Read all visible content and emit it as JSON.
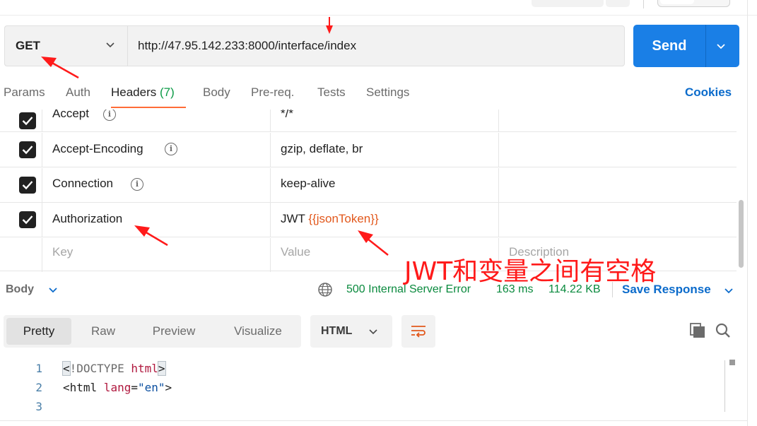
{
  "request": {
    "method": "GET",
    "url": "http://47.95.142.233:8000/interface/index",
    "send_label": "Send"
  },
  "tabs": [
    {
      "label": "Params"
    },
    {
      "label": "Auth"
    },
    {
      "label": "Headers",
      "count": "(7)",
      "active": true
    },
    {
      "label": "Body"
    },
    {
      "label": "Pre-req."
    },
    {
      "label": "Tests"
    },
    {
      "label": "Settings"
    }
  ],
  "cookies_label": "Cookies",
  "headers": [
    {
      "key": "Accept",
      "value": "*/*",
      "checked": true
    },
    {
      "key": "Accept-Encoding",
      "value": "gzip, deflate, br",
      "checked": true
    },
    {
      "key": "Connection",
      "value": "keep-alive",
      "checked": true
    },
    {
      "key": "Authorization",
      "value_prefix": "JWT ",
      "value_var": "{{jsonToken}}",
      "checked": true
    }
  ],
  "placeholders": {
    "key": "Key",
    "value": "Value",
    "description": "Description"
  },
  "response": {
    "body_label": "Body",
    "status": "500 Internal Server Error",
    "time": "163 ms",
    "size": "114.22 KB",
    "save_label": "Save Response"
  },
  "view_modes": [
    {
      "label": "Pretty",
      "active": true
    },
    {
      "label": "Raw"
    },
    {
      "label": "Preview"
    },
    {
      "label": "Visualize"
    }
  ],
  "format": "HTML",
  "code": {
    "line_numbers": [
      "1",
      "2",
      "3"
    ],
    "line1": {
      "open": "<",
      "doctype": "!DOCTYPE ",
      "kw": "html",
      "close": ">"
    },
    "line2": {
      "lt": "<",
      "tag": "html",
      "attr": " lang",
      "eq": "=",
      "val": "\"en\"",
      "gt": ">"
    }
  },
  "annotation": "JWT和变量之间有空格",
  "colors": {
    "accent": "#ff6c37",
    "send": "#1a7fe6",
    "status": "#0a8a3e",
    "link": "#0b6bcb",
    "annotation": "#ff1a1a"
  }
}
